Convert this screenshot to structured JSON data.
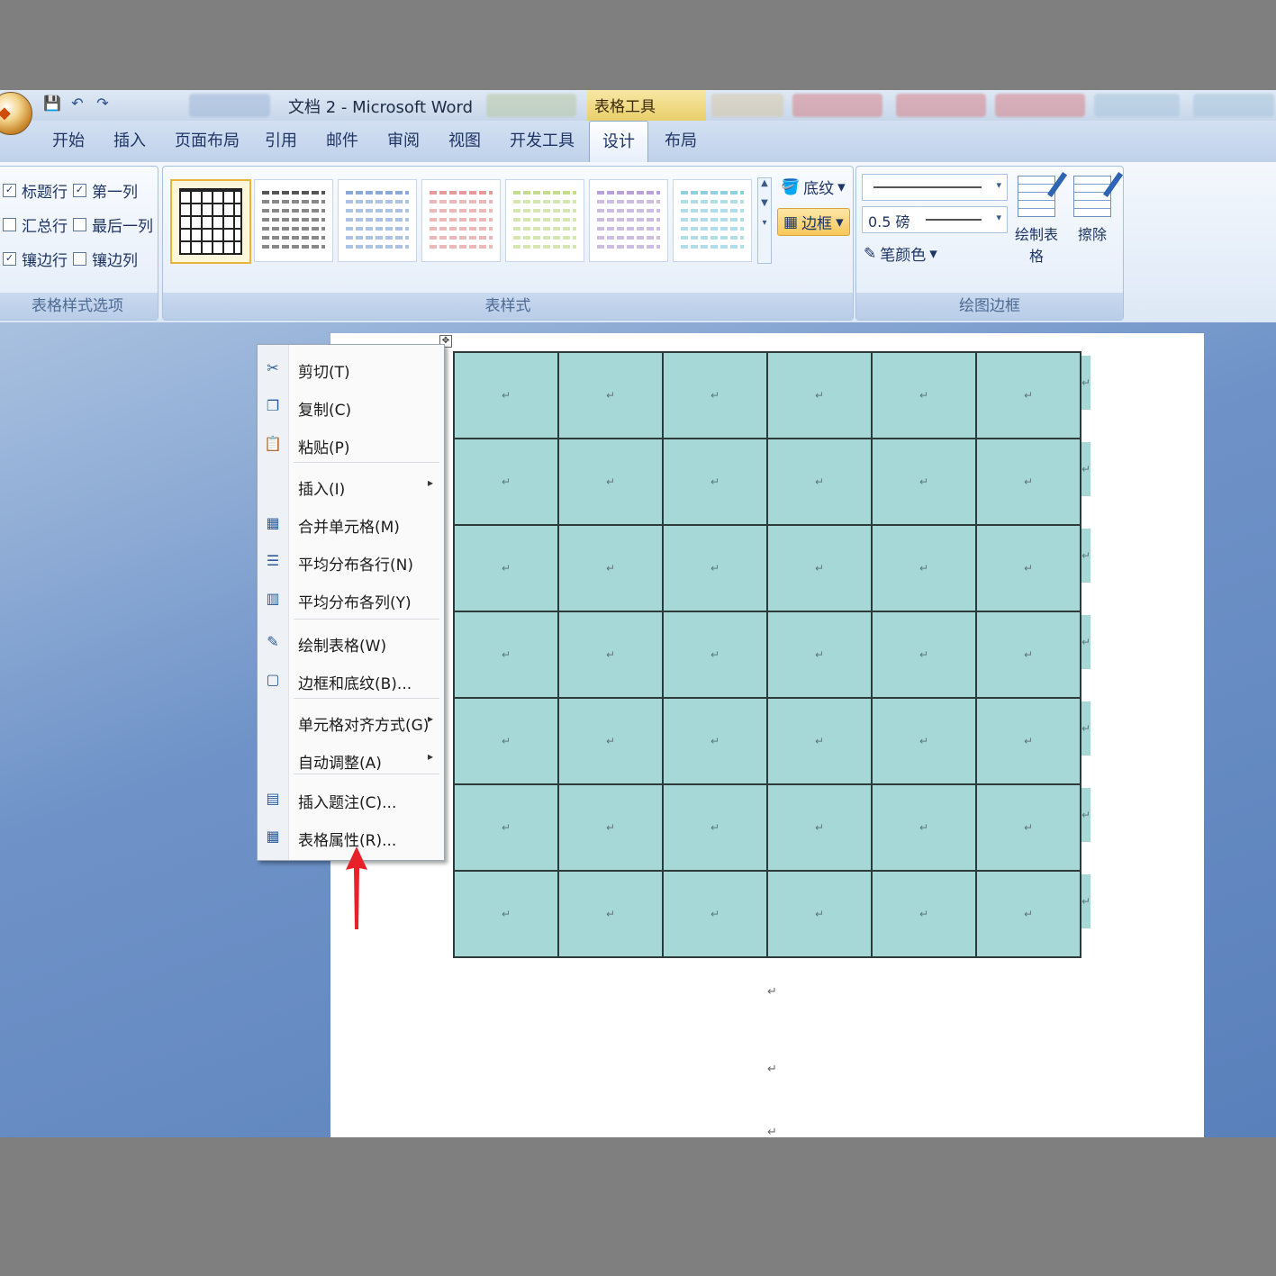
{
  "window": {
    "title": "文档 2 - Microsoft Word",
    "contextual_tab": "表格工具"
  },
  "quick_access": [
    "save-icon",
    "undo-icon",
    "redo-icon"
  ],
  "tabs": [
    {
      "label": "开始"
    },
    {
      "label": "插入"
    },
    {
      "label": "页面布局"
    },
    {
      "label": "引用"
    },
    {
      "label": "邮件"
    },
    {
      "label": "审阅"
    },
    {
      "label": "视图"
    },
    {
      "label": "开发工具"
    },
    {
      "label": "设计",
      "active": true
    },
    {
      "label": "布局"
    }
  ],
  "ribbon": {
    "style_options": {
      "label": "表格样式选项",
      "items": [
        {
          "label": "标题行",
          "checked": true
        },
        {
          "label": "第一列",
          "checked": true
        },
        {
          "label": "汇总行",
          "checked": false
        },
        {
          "label": "最后一列",
          "checked": false
        },
        {
          "label": "镶边行",
          "checked": true
        },
        {
          "label": "镶边列",
          "checked": false
        }
      ]
    },
    "table_styles": {
      "label": "表样式",
      "swatch_colors": [
        "#222222",
        "#555555",
        "#8aa9d8",
        "#e49a9a",
        "#c3dc8e",
        "#b7a1d6",
        "#8fd0de"
      ],
      "shading": "底纹",
      "borders": "边框"
    },
    "draw_borders": {
      "label": "绘图边框",
      "line_weight": "0.5 磅",
      "pen_color": "笔颜色",
      "draw_table": "绘制表格",
      "eraser": "擦除"
    }
  },
  "table": {
    "rows": 7,
    "cols": 6,
    "cell_mark": "↵",
    "fill_color": "#a6d8d8"
  },
  "context_menu": {
    "items": [
      {
        "label": "剪切(T)",
        "icon": "scissors-icon",
        "glyph": "✂"
      },
      {
        "label": "复制(C)",
        "icon": "copy-icon",
        "glyph": "❐"
      },
      {
        "label": "粘贴(P)",
        "icon": "paste-icon",
        "glyph": "📋"
      },
      {
        "label": "插入(I)",
        "icon": "",
        "glyph": "",
        "submenu": true
      },
      {
        "label": "合并单元格(M)",
        "icon": "merge-cells-icon",
        "glyph": "▦"
      },
      {
        "label": "平均分布各行(N)",
        "icon": "distribute-rows-icon",
        "glyph": "☰"
      },
      {
        "label": "平均分布各列(Y)",
        "icon": "distribute-columns-icon",
        "glyph": "▥"
      },
      {
        "label": "绘制表格(W)",
        "icon": "draw-table-icon",
        "glyph": "✎"
      },
      {
        "label": "边框和底纹(B)...",
        "icon": "borders-shading-icon",
        "glyph": "▢"
      },
      {
        "label": "单元格对齐方式(G)",
        "icon": "",
        "glyph": "",
        "submenu": true
      },
      {
        "label": "自动调整(A)",
        "icon": "",
        "glyph": "",
        "submenu": true
      },
      {
        "label": "插入题注(C)...",
        "icon": "insert-caption-icon",
        "glyph": "▤"
      },
      {
        "label": "表格属性(R)...",
        "icon": "table-properties-icon",
        "glyph": "▦"
      }
    ]
  },
  "annotation": {
    "arrow_color": "#e8202a"
  }
}
